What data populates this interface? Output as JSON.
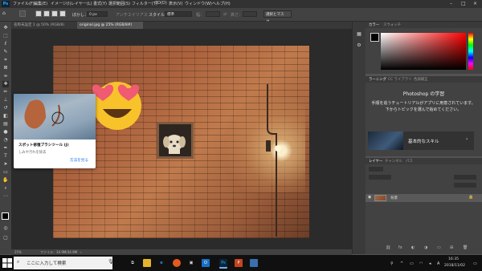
{
  "menu": {
    "items": [
      "ファイル(F)",
      "編集(E)",
      "イメージ(I)",
      "レイヤー(L)",
      "書式(Y)",
      "選択範囲(S)",
      "フィルター(T)",
      "3D(D)",
      "表示(V)",
      "ウィンドウ(W)",
      "ヘルプ(H)"
    ],
    "app_logo": "Ps"
  },
  "options_bar": {
    "feather_label": "ぼかし：",
    "feather_value": "0 px",
    "antialias_label": "アンチエイリアス",
    "style_label": "スタイル：",
    "style_value": "標準",
    "width_label": "幅：",
    "height_label": "高さ：",
    "select_mask_button": "選択とマスク..."
  },
  "document_tabs": [
    {
      "label": "名称未設定 1 @ 50% (RGB/8)",
      "active": false
    },
    {
      "label": "original.jpg @ 25% (RGB/8#)",
      "active": true
    }
  ],
  "tooltip": {
    "title": "スポット修復ブラシツール (J)",
    "description": "しみや汚れを除去",
    "link": "方法を見る"
  },
  "status_bar": {
    "zoom": "25%",
    "file_info": "ファイル：34.9M/34.9M"
  },
  "color_panel": {
    "tabs": [
      "カラー",
      "スウォッチ"
    ],
    "active_tab": "カラー"
  },
  "learn_panel": {
    "tabs": [
      "ラーニング",
      "CC ライブラリ",
      "色調補正"
    ],
    "title": "Photoshop の学習",
    "body": "手順を追うチュートリアルがアプリに用意されています。下からトピックを選んで始めてください。",
    "skill_card": "基本的なスキル"
  },
  "layers_panel": {
    "tabs": [
      "レイヤー",
      "チャンネル",
      "パス"
    ],
    "layer_name": "背景"
  },
  "taskbar": {
    "search_placeholder": "ここに入力して検索",
    "time": "16:35",
    "date": "2018/11/02",
    "icons": [
      "task-view-icon",
      "file-explorer-icon",
      "edge-icon",
      "firefox-icon",
      "store-icon",
      "outlook-icon",
      "photoshop-icon",
      "powerpoint-icon",
      "generic-app-icon"
    ]
  },
  "colors": {
    "ui_dark": "#323232",
    "ui_mid": "#424242",
    "canvas_bg": "#2b2b2b",
    "accent_link": "#1473e6",
    "ps_blue": "#31a8ff"
  }
}
